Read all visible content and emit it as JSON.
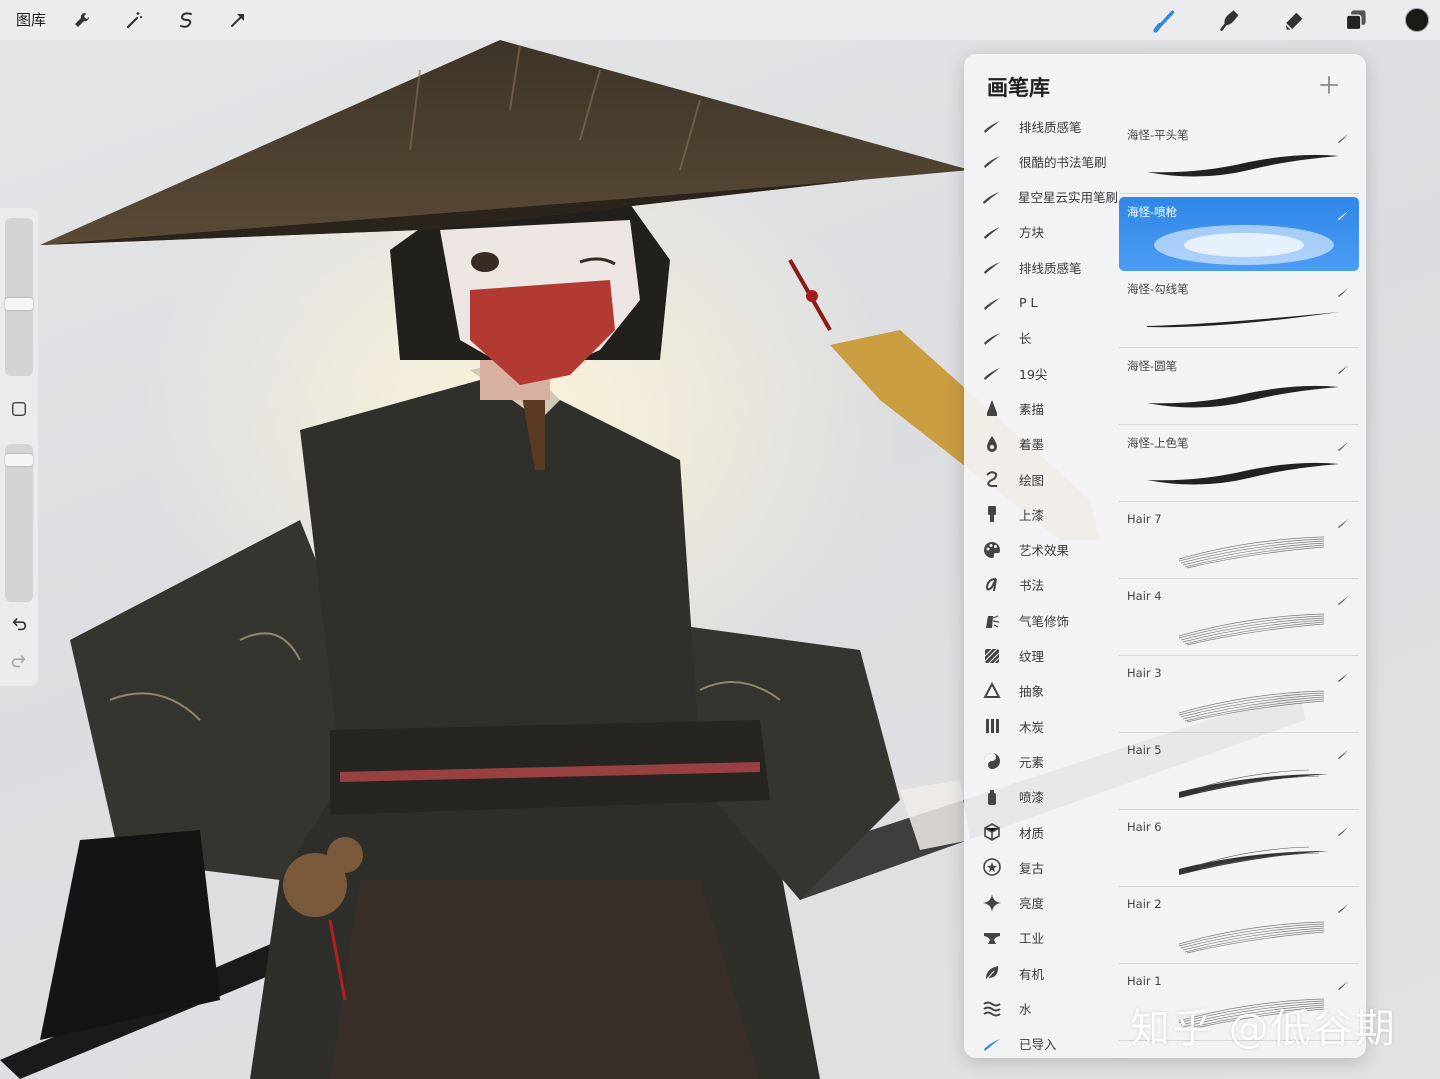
{
  "topbar": {
    "gallery_label": "图库",
    "tools_left": [
      "wrench-icon",
      "magic-wand-icon",
      "selection-icon",
      "transform-arrow-icon"
    ],
    "tools_right": [
      "brush-icon",
      "smudge-icon",
      "eraser-icon",
      "layers-icon"
    ],
    "current_color": "#1c1a14",
    "accent": "#2f87e8"
  },
  "sidebar": {
    "controls": [
      "brush-size-slider",
      "modify-square-button",
      "opacity-slider",
      "undo-icon",
      "redo-icon"
    ]
  },
  "brush_library": {
    "title": "画笔库",
    "add_button": "+",
    "categories": [
      {
        "label": "排线质感笔",
        "icon": "stroke-icon"
      },
      {
        "label": "很酷的书法笔刷",
        "icon": "stroke-icon"
      },
      {
        "label": "星空星云实用笔刷",
        "icon": "stroke-icon"
      },
      {
        "label": "方块",
        "icon": "stroke-icon"
      },
      {
        "label": "排线质感笔",
        "icon": "stroke-icon"
      },
      {
        "label": "P L",
        "icon": "stroke-icon"
      },
      {
        "label": "长",
        "icon": "stroke-icon"
      },
      {
        "label": "19尖",
        "icon": "stroke-icon"
      },
      {
        "label": "素描",
        "icon": "pencil-tip-icon"
      },
      {
        "label": "着墨",
        "icon": "ink-drop-icon"
      },
      {
        "label": "绘图",
        "icon": "scribble-icon"
      },
      {
        "label": "上漆",
        "icon": "paintbrush-icon"
      },
      {
        "label": "艺术效果",
        "icon": "palette-icon"
      },
      {
        "label": "书法",
        "icon": "calligraphy-icon"
      },
      {
        "label": "气笔修饰",
        "icon": "airbrush-icon"
      },
      {
        "label": "纹理",
        "icon": "texture-icon"
      },
      {
        "label": "抽象",
        "icon": "triangle-icon"
      },
      {
        "label": "木炭",
        "icon": "charcoal-icon"
      },
      {
        "label": "元素",
        "icon": "yin-yang-icon"
      },
      {
        "label": "喷漆",
        "icon": "spray-can-icon"
      },
      {
        "label": "材质",
        "icon": "cube-icon"
      },
      {
        "label": "复古",
        "icon": "star-circle-icon"
      },
      {
        "label": "亮度",
        "icon": "sparkle-icon"
      },
      {
        "label": "工业",
        "icon": "anvil-icon"
      },
      {
        "label": "有机",
        "icon": "leaf-icon"
      },
      {
        "label": "水",
        "icon": "waves-icon"
      },
      {
        "label": "已导入",
        "icon": "imported-stroke-icon"
      }
    ],
    "brushes": [
      {
        "name": "海怪-平头笔",
        "preview": "taper-thick",
        "selected": false
      },
      {
        "name": "海怪-喷枪",
        "preview": "airbrush-glow",
        "selected": true
      },
      {
        "name": "海怪-勾线笔",
        "preview": "thin-line",
        "selected": false
      },
      {
        "name": "海怪-圆笔",
        "preview": "taper-thick",
        "selected": false
      },
      {
        "name": "海怪-上色笔",
        "preview": "taper-thick",
        "selected": false
      },
      {
        "name": "Hair 7",
        "preview": "hair",
        "selected": false
      },
      {
        "name": "Hair 4",
        "preview": "hair",
        "selected": false
      },
      {
        "name": "Hair 3",
        "preview": "hair",
        "selected": false
      },
      {
        "name": "Hair 5",
        "preview": "hair-dark",
        "selected": false
      },
      {
        "name": "Hair 6",
        "preview": "hair-dark",
        "selected": false
      },
      {
        "name": "Hair 2",
        "preview": "hair",
        "selected": false
      },
      {
        "name": "Hair 1",
        "preview": "hair",
        "selected": false
      }
    ]
  },
  "watermark": "知乎 @低谷期"
}
